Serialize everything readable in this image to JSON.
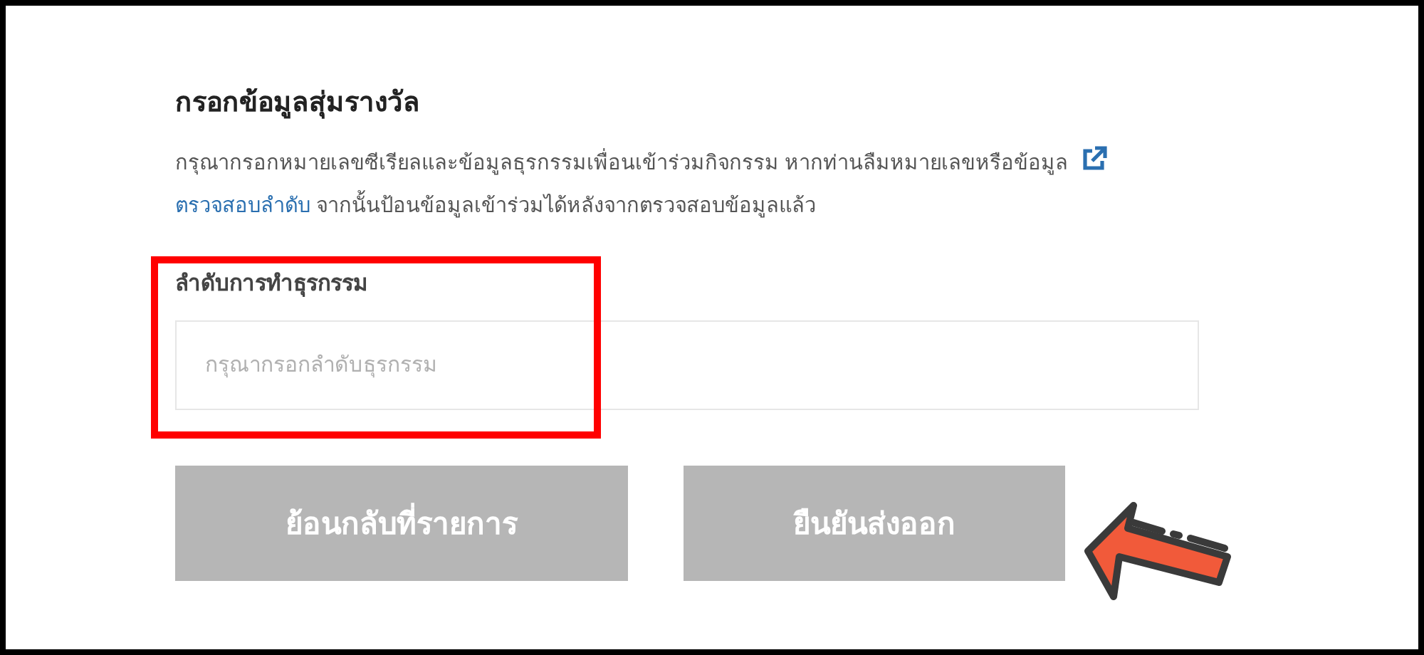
{
  "form": {
    "title": "กรอกข้อมูลสุ่มรางวัล",
    "description": {
      "text_before": "กรุณากรอกหมายเลขซีเรียลและข้อมูลธุรกรรมเพื่อนเข้าร่วมกิจกรรม หากท่านลืมหมายเลขหรือข้อมูล",
      "link": "ตรวจสอบลำดับ",
      "text_after": "จากนั้นป้อนข้อมูลเข้าร่วมได้หลังจากตรวจสอบข้อมูลแล้ว"
    },
    "field": {
      "label": "ลำดับการทำธุรกรรม",
      "placeholder": "กรุณากรอกลำดับธุรกรรม"
    },
    "buttons": [
      {
        "label": "ย้อนกลับที่รายการ",
        "disabled": true
      },
      {
        "label": "ยืนยันส่งออก",
        "disabled": true
      }
    ]
  }
}
